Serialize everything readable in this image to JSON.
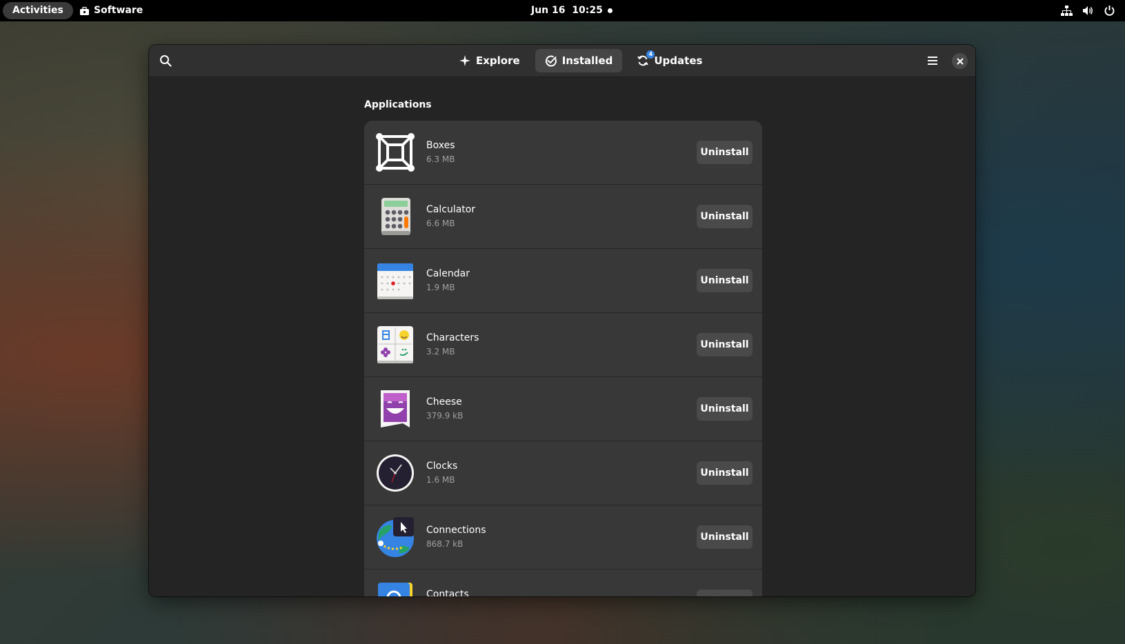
{
  "topbar": {
    "activities": "Activities",
    "app_name": "Software",
    "date": "Jun 16",
    "time": "10:25"
  },
  "headerbar": {
    "tabs": [
      {
        "label": "Explore",
        "icon": "sparkle-icon"
      },
      {
        "label": "Installed",
        "icon": "check-circle-icon"
      },
      {
        "label": "Updates",
        "icon": "refresh-icon",
        "badge": "4"
      }
    ],
    "active_tab": "Installed"
  },
  "main": {
    "section_title": "Applications",
    "apps": [
      {
        "name": "Boxes",
        "size": "6.3 MB",
        "action": "Uninstall"
      },
      {
        "name": "Calculator",
        "size": "6.6 MB",
        "action": "Uninstall"
      },
      {
        "name": "Calendar",
        "size": "1.9 MB",
        "action": "Uninstall"
      },
      {
        "name": "Characters",
        "size": "3.2 MB",
        "action": "Uninstall"
      },
      {
        "name": "Cheese",
        "size": "379.9 kB",
        "action": "Uninstall"
      },
      {
        "name": "Clocks",
        "size": "1.6 MB",
        "action": "Uninstall"
      },
      {
        "name": "Connections",
        "size": "868.7 kB",
        "action": "Uninstall"
      },
      {
        "name": "Contacts",
        "size": "",
        "action": ""
      }
    ]
  },
  "colors": {
    "accent": "#3584e4",
    "window_bg": "#242424",
    "card_bg": "#383838",
    "button_bg": "#4a4a4a"
  }
}
